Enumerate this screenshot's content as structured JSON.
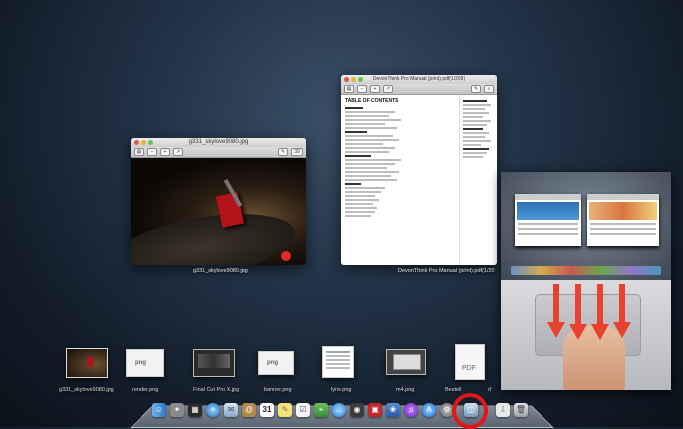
{
  "windows": {
    "photo": {
      "title": "g331_skylove9080.jpg",
      "caption": "g331_skylove9080.jpg",
      "zoom_count": "39"
    },
    "manual": {
      "title": "DevonThink Pro Manual (print).pdf(1/209) ",
      "caption": "DevonThink Pro Manual (print).pdf(1/20",
      "toc_heading": "TABLE OF CONTENTS"
    }
  },
  "shelf": [
    {
      "label": "g331_skylove9080.jpg",
      "icon": "photo-thumbnail-icon"
    },
    {
      "label": "render.png",
      "icon": "png-file-icon",
      "badge": "png"
    },
    {
      "label": "Final Cut Pro X.jpg",
      "icon": "screenshot-thumbnail-icon"
    },
    {
      "label": "banner.png",
      "icon": "png-file-icon",
      "badge": "png"
    },
    {
      "label": "lynx.png",
      "icon": "document-thumbnail-icon"
    },
    {
      "label": "m4.png",
      "icon": "screen-thumbnail-icon"
    },
    {
      "label": "Bestell",
      "icon": "pdf-file-icon",
      "badge": "PDF"
    }
  ],
  "shelf_suffix": "rf",
  "dock": {
    "calendar_date": "31",
    "items": [
      "finder",
      "launchpad",
      "mission-control",
      "safari",
      "mail",
      "contacts",
      "calendar",
      "notes",
      "reminders",
      "maps",
      "messages",
      "facetime",
      "photo-booth",
      "iphoto",
      "itunes",
      "app-store",
      "system-preferences",
      "preview",
      "download-stack",
      "trash"
    ]
  },
  "colors": {
    "highlight_ring": "#e0161a",
    "gesture_arrow": "#e8412e"
  }
}
